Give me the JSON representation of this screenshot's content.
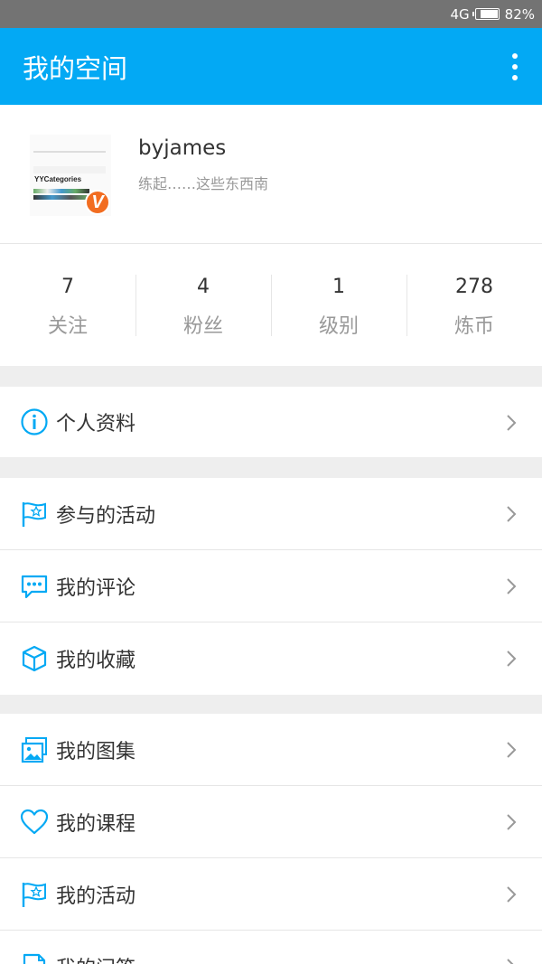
{
  "status_bar": {
    "network": "4G",
    "battery": "82%",
    "battery_level": 0.82
  },
  "app_bar": {
    "title": "我的空间"
  },
  "profile": {
    "username": "byjames",
    "signature": "练起……这些东西南",
    "avatar_title": "YYCategories",
    "vip_badge": "V"
  },
  "stats": [
    {
      "value": "7",
      "label": "关注"
    },
    {
      "value": "4",
      "label": "粉丝"
    },
    {
      "value": "1",
      "label": "级别"
    },
    {
      "value": "278",
      "label": "炼币"
    }
  ],
  "menu": {
    "group1": [
      {
        "label": "个人资料",
        "icon": "info-icon"
      }
    ],
    "group2": [
      {
        "label": "参与的活动",
        "icon": "flag-star-icon"
      },
      {
        "label": "我的评论",
        "icon": "comment-icon"
      },
      {
        "label": "我的收藏",
        "icon": "box-icon"
      }
    ],
    "group3": [
      {
        "label": "我的图集",
        "icon": "image-icon"
      },
      {
        "label": "我的课程",
        "icon": "heart-icon"
      },
      {
        "label": "我的活动",
        "icon": "flag-star-icon"
      },
      {
        "label": "我的问答",
        "icon": "document-icon"
      }
    ]
  },
  "colors": {
    "primary": "#03a9f4",
    "status_bar": "#737373",
    "badge": "#f26d21"
  }
}
